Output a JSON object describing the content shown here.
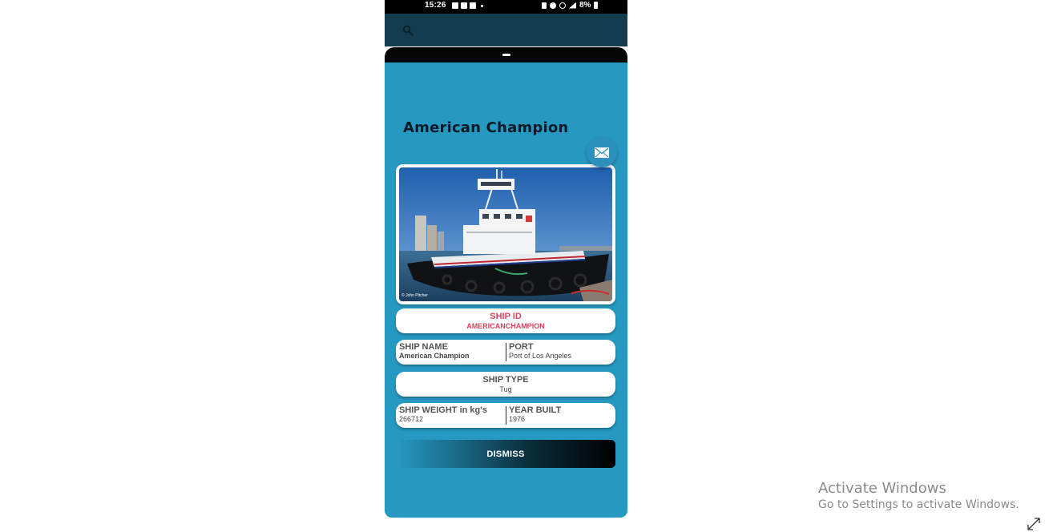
{
  "status_bar": {
    "time": "15:26",
    "battery": "8%"
  },
  "search": {
    "icon": "search-icon"
  },
  "ship": {
    "title": "American Champion",
    "photo_credit": "© John Pitcher",
    "id_label": "SHIP ID",
    "id_value": "AMERICANCHAMPION",
    "name_label": "SHIP NAME",
    "name_value": "American Champion",
    "port_label": "PORT",
    "port_value": "Port of Los Angeles",
    "type_label": "SHIP TYPE",
    "type_value": "Tug",
    "weight_label": "SHIP WEIGHT in kg's",
    "weight_value": "266712",
    "year_label": "YEAR BUILT",
    "year_value": "1976"
  },
  "actions": {
    "dismiss": "DISMISS",
    "email_icon": "mail-icon"
  },
  "watermark": {
    "title": "Activate Windows",
    "subtitle": "Go to Settings to activate Windows."
  },
  "colors": {
    "sheet": "#2699c2",
    "searchbar": "#133c4e",
    "id_text": "#e0405f"
  }
}
